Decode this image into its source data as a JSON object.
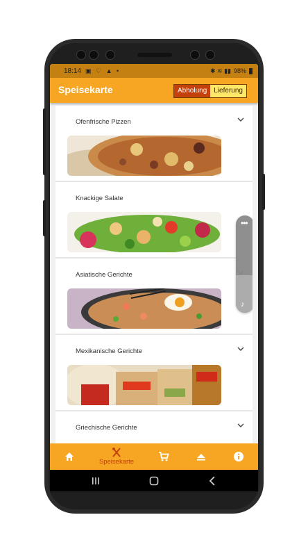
{
  "status_bar": {
    "time": "18:14",
    "left_icons": "▣ ♡ ▲ •",
    "right_icons": "✱ ≋ ▮▮",
    "battery_percent": "98%"
  },
  "app_bar": {
    "title": "Speisekarte",
    "mode_toggle": {
      "options": [
        "Abholung",
        "Lieferung"
      ],
      "selected": "Abholung"
    }
  },
  "menu_categories": [
    {
      "label": "Ofenfrische Pizzen",
      "image": "pizza-photo"
    },
    {
      "label": "Knackige Salate",
      "image": "salad-photo"
    },
    {
      "label": "Asiatische Gerichte",
      "image": "fried-rice-photo"
    },
    {
      "label": "Mexikanische Gerichte",
      "image": "fajitas-photo"
    },
    {
      "label": "Griechische Gerichte",
      "image": "greek-food-photo"
    }
  ],
  "bottom_nav": {
    "items": [
      {
        "icon": "home-icon",
        "label": ""
      },
      {
        "icon": "fork-knife-icon",
        "label": "Speisekarte",
        "active": true
      },
      {
        "icon": "cart-icon",
        "label": ""
      },
      {
        "icon": "eject-icon",
        "label": ""
      },
      {
        "icon": "info-icon",
        "label": ""
      }
    ]
  },
  "colors": {
    "primary": "#f6a623",
    "status_bar": "#c48112",
    "toggle_active": "#c4410c",
    "toggle_inactive": "#ffe76a",
    "nav_active": "#c4410c"
  }
}
